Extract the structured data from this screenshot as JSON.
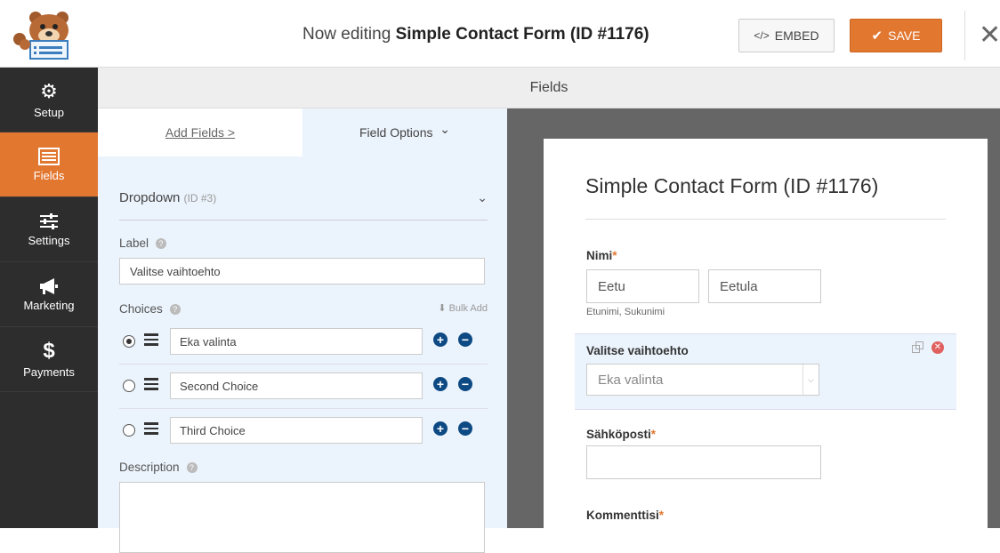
{
  "header": {
    "editing_prefix": "Now editing",
    "form_name": "Simple Contact Form (ID #1176)",
    "embed_label": "EMBED",
    "embed_icon": "</>",
    "save_label": "SAVE",
    "close_icon": "close-icon"
  },
  "sidebar": {
    "items": [
      {
        "label": "Setup",
        "icon": "gear-icon",
        "active": false
      },
      {
        "label": "Fields",
        "icon": "fields-icon",
        "active": true
      },
      {
        "label": "Settings",
        "icon": "sliders-icon",
        "active": false
      },
      {
        "label": "Marketing",
        "icon": "megaphone-icon",
        "active": false
      },
      {
        "label": "Payments",
        "icon": "dollar-icon",
        "active": false
      }
    ]
  },
  "fields_header": "Fields",
  "panel": {
    "tab_add": "Add Fields",
    "tab_add_chevron": ">",
    "tab_options": "Field Options",
    "tab_options_chevron": "⌄",
    "field_type": "Dropdown",
    "field_id": "(ID #3)",
    "label_title": "Label",
    "label_value": "Valitse vaihtoehto",
    "choices_title": "Choices",
    "bulk_add": "Bulk Add",
    "choices": [
      {
        "value": "Eka valinta",
        "selected": true
      },
      {
        "value": "Second Choice",
        "selected": false
      },
      {
        "value": "Third Choice",
        "selected": false
      }
    ],
    "description_title": "Description",
    "help_icon": "?"
  },
  "preview": {
    "title": "Simple Contact Form (ID #1176)",
    "name_label": "Nimi",
    "required_mark": "*",
    "first_name": "Eetu",
    "last_name": "Eetula",
    "name_sub": "Etunimi, Sukunimi",
    "dropdown_label": "Valitse vaihtoehto",
    "dropdown_value": "Eka valinta",
    "email_label": "Sähköposti",
    "comment_label": "Kommenttisi"
  },
  "colors": {
    "accent": "#e27730",
    "sidebar": "#2d2d2d",
    "panel": "#ebf3fc",
    "choice_buttons": "#0d4a84"
  }
}
